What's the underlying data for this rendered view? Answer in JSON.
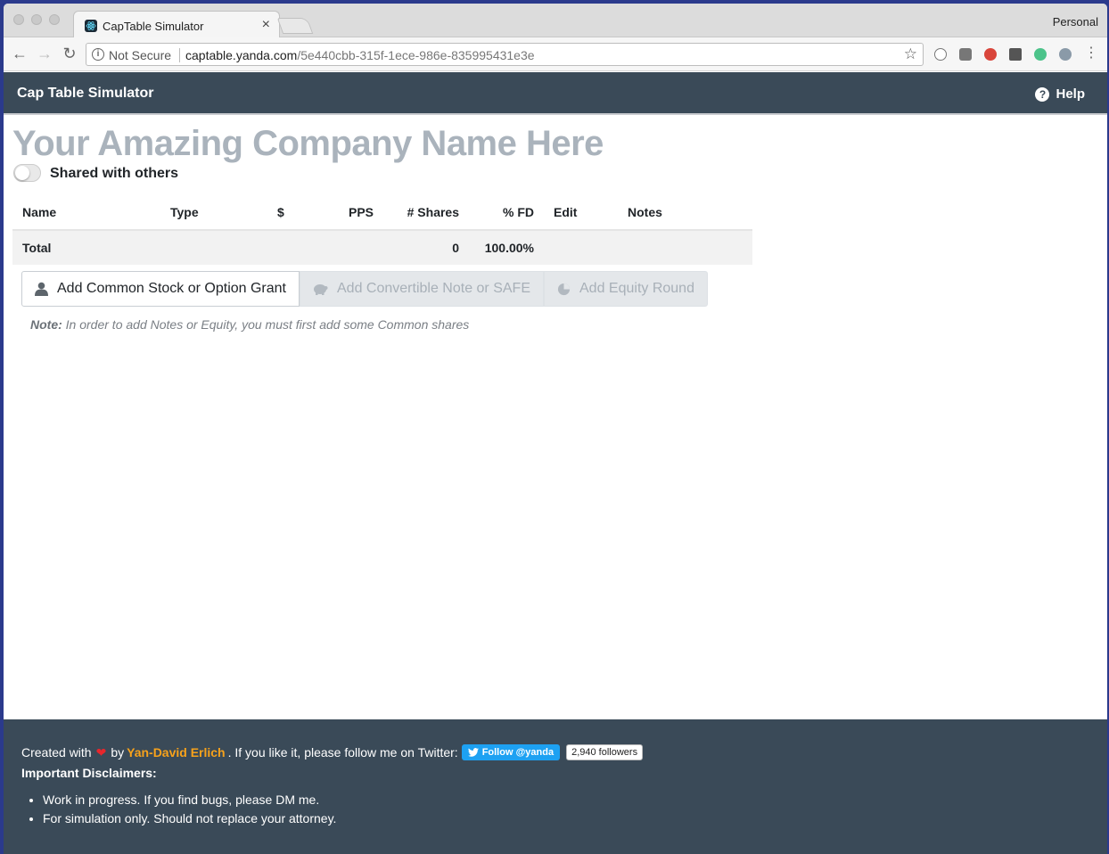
{
  "browser": {
    "tab_title": "CapTable Simulator",
    "tab_close": "×",
    "profile": "Personal",
    "security_label": "Not Secure",
    "url_host": "captable.yanda.com",
    "url_path": "/5e440cbb-315f-1ece-986e-835995431e3e"
  },
  "app": {
    "brand": "Cap Table Simulator",
    "help_label": "Help"
  },
  "company": {
    "name": "Your Amazing Company Name Here",
    "shared_label": "Shared with others",
    "shared": false
  },
  "table": {
    "headers": [
      "Name",
      "Type",
      "$",
      "PPS",
      "# Shares",
      "% FD",
      "Edit",
      "Notes"
    ],
    "total": {
      "label": "Total",
      "type": "",
      "amount": "",
      "pps": "",
      "shares": "0",
      "fd": "100.00%",
      "edit": "",
      "notes": ""
    }
  },
  "actions": {
    "add_common": "Add Common Stock or Option Grant",
    "add_convertible": "Add Convertible Note or SAFE",
    "add_equity": "Add Equity Round"
  },
  "note": {
    "label": "Note:",
    "text": " In order to add Notes or Equity, you must first add some Common shares"
  },
  "footer": {
    "created_with": "Created with",
    "by": "by",
    "author": "Yan-David Erlich",
    "follow_text": ". If you like it, please follow me on Twitter:",
    "twitter_button": "Follow @yanda",
    "followers": "2,940 followers",
    "disclaimers_title": "Important Disclaimers:",
    "disclaimers": [
      "Work in progress. If you find bugs, please DM me.",
      "For simulation only. Should not replace your attorney."
    ]
  }
}
